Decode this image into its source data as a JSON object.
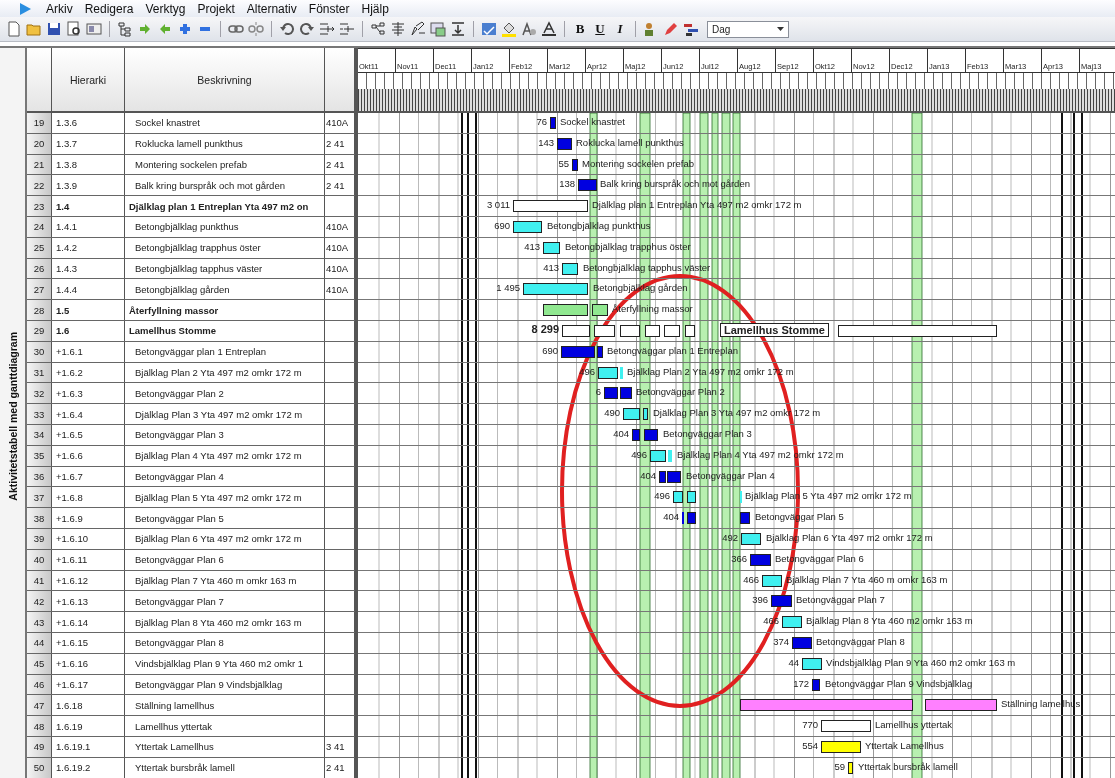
{
  "menu": [
    "Arkiv",
    "Redigera",
    "Verktyg",
    "Projekt",
    "Alternativ",
    "Fönster",
    "Hjälp"
  ],
  "toolbar": {
    "format_buttons": [
      "B",
      "U",
      "I"
    ],
    "scale_dropdown": {
      "value": "Dag"
    }
  },
  "side_label": "Aktivitetstabell med ganttdiagram",
  "table": {
    "columns": [
      "Hierarki",
      "Beskrivning"
    ],
    "rows": [
      {
        "number": "19",
        "wbs": "1.3.6",
        "description": "Sockel knastret",
        "column_4": "410A",
        "kind": "task"
      },
      {
        "number": "20",
        "wbs": "1.3.7",
        "description": "Roklucka lamell punkthus",
        "column_4": "2 41",
        "kind": "task"
      },
      {
        "number": "21",
        "wbs": "1.3.8",
        "description": "Montering sockelen prefab",
        "column_4": "2 41",
        "kind": "task"
      },
      {
        "number": "22",
        "wbs": "1.3.9",
        "description": "Balk kring burspråk och mot gården",
        "column_4": "2 41",
        "kind": "task"
      },
      {
        "number": "23",
        "wbs": "1.4",
        "description": "Djälklag plan 1 Entreplan Yta 497 m2 on",
        "kind": "summary"
      },
      {
        "number": "24",
        "wbs": "1.4.1",
        "description": "Betongbjälklag punkthus",
        "column_4": "410A",
        "kind": "task"
      },
      {
        "number": "25",
        "wbs": "1.4.2",
        "description": "Betongbjälklag trapphus öster",
        "column_4": "410A",
        "kind": "task"
      },
      {
        "number": "26",
        "wbs": "1.4.3",
        "description": "Betongbjälklag tapphus väster",
        "column_4": "410A",
        "kind": "task"
      },
      {
        "number": "27",
        "wbs": "1.4.4",
        "description": "Betongbjälklag gården",
        "column_4": "410A",
        "kind": "task"
      },
      {
        "number": "28",
        "wbs": "1.5",
        "description": "Återfyllning massor",
        "kind": "summary"
      },
      {
        "number": "29",
        "wbs": "1.6",
        "description": "Lamellhus Stomme",
        "kind": "summary"
      },
      {
        "number": "30",
        "wbs": "+1.6.1",
        "description": "Betongväggar plan 1 Entreplan",
        "kind": "task"
      },
      {
        "number": "31",
        "wbs": "+1.6.2",
        "description": "Bjälklag Plan 2 Yta 497 m2 omkr 172 m",
        "kind": "task"
      },
      {
        "number": "32",
        "wbs": "+1.6.3",
        "description": "Betongväggar Plan 2",
        "kind": "task"
      },
      {
        "number": "33",
        "wbs": "+1.6.4",
        "description": "Djälklag Plan 3 Yta 497 m2 omkr 172 m",
        "kind": "task"
      },
      {
        "number": "34",
        "wbs": "+1.6.5",
        "description": "Betongväggar Plan 3",
        "kind": "task"
      },
      {
        "number": "35",
        "wbs": "+1.6.6",
        "description": "Bjälklag Plan 4 Yta 497 m2 omkr 172 m",
        "kind": "task"
      },
      {
        "number": "36",
        "wbs": "+1.6.7",
        "description": "Betongväggar Plan 4",
        "kind": "task"
      },
      {
        "number": "37",
        "wbs": "+1.6.8",
        "description": "Bjälklag Plan 5 Yta 497 m2 omkr 172 m",
        "kind": "task"
      },
      {
        "number": "38",
        "wbs": "+1.6.9",
        "description": "Betongväggar Plan 5",
        "kind": "task"
      },
      {
        "number": "39",
        "wbs": "+1.6.10",
        "description": "Bjälklag Plan 6 Yta 497 m2 omkr 172 m",
        "kind": "task"
      },
      {
        "number": "40",
        "wbs": "+1.6.11",
        "description": "Betongväggar Plan 6",
        "kind": "task"
      },
      {
        "number": "41",
        "wbs": "+1.6.12",
        "description": "Bjälklag Plan 7 Yta 460 m omkr 163 m",
        "kind": "task"
      },
      {
        "number": "42",
        "wbs": "+1.6.13",
        "description": "Betongväggar Plan 7",
        "kind": "task"
      },
      {
        "number": "43",
        "wbs": "+1.6.14",
        "description": "Bjälklag Plan 8 Yta 460 m2 omkr 163 m",
        "kind": "task"
      },
      {
        "number": "44",
        "wbs": "+1.6.15",
        "description": "Betongväggar Plan 8",
        "kind": "task"
      },
      {
        "number": "45",
        "wbs": "+1.6.16",
        "description": "Vindsbjälklag Plan 9 Yta 460 m2 omkr 1",
        "kind": "task"
      },
      {
        "number": "46",
        "wbs": "+1.6.17",
        "description": "Betongväggar Plan 9 Vindsbjälklag",
        "kind": "task"
      },
      {
        "number": "47",
        "wbs": "1.6.18",
        "description": "Ställning lamellhus",
        "kind": "task"
      },
      {
        "number": "48",
        "wbs": "1.6.19",
        "description": "Lamellhus yttertak",
        "kind": "task"
      },
      {
        "number": "49",
        "wbs": "1.6.19.1",
        "description": "Yttertak Lamellhus",
        "column_4": "3 41",
        "kind": "task"
      },
      {
        "number": "50",
        "wbs": "1.6.19.2",
        "description": "Yttertak bursbråk lamell",
        "column_4": "2 41",
        "kind": "task"
      }
    ]
  },
  "gantt": {
    "months": [
      "Okt11",
      "Nov11",
      "Dec11",
      "Jan12",
      "Feb12",
      "Mar12",
      "Apr12",
      "Maj12",
      "Jun12",
      "Jul12",
      "Aug12",
      "Sep12",
      "Okt12",
      "Nov12",
      "Dec12",
      "Jan13",
      "Feb13",
      "Mar13",
      "Apr13",
      "Maj13"
    ],
    "bars": [
      {
        "duration": "76",
        "label": "Sockel knastret",
        "color": "#0000e0",
        "kind": "task"
      },
      {
        "duration": "143",
        "label": "Roklucka lamell punkthus",
        "color": "#0000e0",
        "kind": "task"
      },
      {
        "duration": "55",
        "label": "Montering sockelen prefab",
        "color": "#0000e0",
        "kind": "task"
      },
      {
        "duration": "138",
        "label": "Balk kring burspråk och mot gården",
        "color": "#0000e0",
        "kind": "task"
      },
      {
        "duration": "3 011",
        "label": "Djälklag plan 1 Entreplan Yta 497 m2 omkr 172 m",
        "color": "#ffffff",
        "kind": "task"
      },
      {
        "duration": "690",
        "label": "Betongbjälklag punkthus",
        "color": "#40f0f0",
        "kind": "task"
      },
      {
        "duration": "413",
        "label": "Betongbjälklag trapphus öster",
        "color": "#40f0f0",
        "kind": "task"
      },
      {
        "duration": "413",
        "label": "Betongbjälklag tapphus väster",
        "color": "#40f0f0",
        "kind": "task"
      },
      {
        "duration": "1 495",
        "label": "Betongbjälklag gården",
        "color": "#40f0f0",
        "kind": "task"
      },
      {
        "label": "Återfyllning massor",
        "color": "#90e890",
        "kind": "task"
      },
      {
        "duration": "8 299",
        "label": "Lamellhus Stomme",
        "color": "#ffffff",
        "kind": "summary"
      },
      {
        "duration": "690",
        "label": "Betongväggar plan 1 Entreplan",
        "color": "#0000e0",
        "kind": "task"
      },
      {
        "duration": "496",
        "label": "Bjälklag Plan 2 Yta 497 m2 omkr 172 m",
        "color": "#40f0f0",
        "kind": "task"
      },
      {
        "duration": "6",
        "label": "Betongväggar Plan 2",
        "color": "#0000e0",
        "kind": "task"
      },
      {
        "duration": "490",
        "label": "Djälklag Plan 3 Yta 497 m2 omkr 172 m",
        "color": "#40f0f0",
        "kind": "task"
      },
      {
        "duration": "404",
        "label": "Betongväggar Plan 3",
        "color": "#0000e0",
        "kind": "task"
      },
      {
        "duration": "496",
        "label": "Bjälklag Plan 4 Yta 497 m2 omkr 172 m",
        "color": "#40f0f0",
        "kind": "task"
      },
      {
        "duration": "404",
        "label": "Betongväggar Plan 4",
        "color": "#0000e0",
        "kind": "task"
      },
      {
        "duration": "496",
        "label": "Bjälklag Plan 5 Yta 497 m2 omkr 172 m",
        "color": "#40f0f0",
        "kind": "task"
      },
      {
        "duration": "404",
        "label": "Betongväggar Plan 5",
        "color": "#0000e0",
        "kind": "task"
      },
      {
        "duration": "492",
        "label": "Bjälklag Plan 6 Yta 497 m2 omkr 172 m",
        "color": "#40f0f0",
        "kind": "task"
      },
      {
        "duration": "366",
        "label": "Betongväggar Plan 6",
        "color": "#0000e0",
        "kind": "task"
      },
      {
        "duration": "466",
        "label": "Bjälklag Plan 7 Yta 460 m omkr 163 m",
        "color": "#40f0f0",
        "kind": "task"
      },
      {
        "duration": "396",
        "label": "Betongväggar Plan 7",
        "color": "#0000e0",
        "kind": "task"
      },
      {
        "duration": "466",
        "label": "Bjälklag Plan 8 Yta 460 m2 omkr 163 m",
        "color": "#40f0f0",
        "kind": "task"
      },
      {
        "duration": "374",
        "label": "Betongväggar Plan 8",
        "color": "#0000e0",
        "kind": "task"
      },
      {
        "duration": "44",
        "label": "Vindsbjälklag Plan 9 Yta 460 m2 omkr 163 m",
        "color": "#40f0f0",
        "kind": "task"
      },
      {
        "duration": "172",
        "label": "Betongväggar Plan 9 Vindsbjälklag",
        "color": "#0000e0",
        "kind": "task"
      },
      {
        "label": "Ställning lamellhus",
        "color": "#ff80ff",
        "kind": "task"
      },
      {
        "duration": "770",
        "label": "Lamellhus yttertak",
        "color": "#ffffff",
        "kind": "task"
      },
      {
        "duration": "554",
        "label": "Yttertak Lamellhus",
        "color": "#ffff00",
        "kind": "task"
      },
      {
        "duration": "59",
        "label": "Yttertak bursbråk lamell",
        "color": "#ffff00",
        "kind": "task"
      }
    ]
  }
}
